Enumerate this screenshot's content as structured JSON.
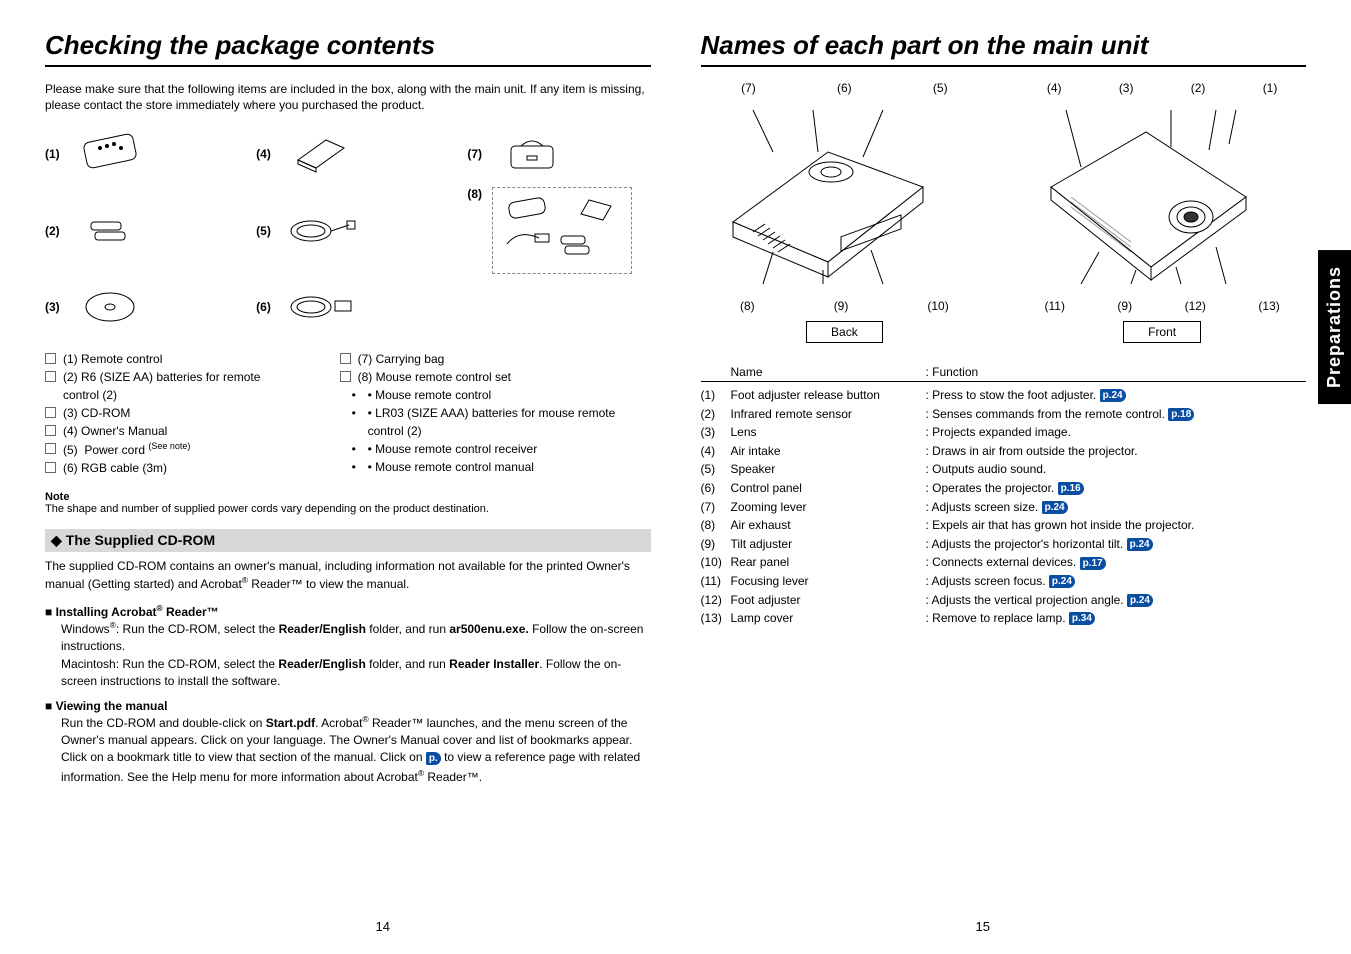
{
  "left": {
    "title": "Checking the package contents",
    "intro": "Please make sure that the following items are included in the box, along with the main unit. If any item is missing, please contact the store immediately where you purchased the product.",
    "item_labels": [
      "(1)",
      "(2)",
      "(3)",
      "(4)",
      "(5)",
      "(6)",
      "(7)",
      "(8)"
    ],
    "checklist_col1": [
      "(1)  Remote control",
      "(2)  R6 (SIZE AA) batteries for remote control (2)",
      "(3)  CD-ROM",
      "(4)  Owner's Manual",
      "(5)  Power cord (See note)",
      "(6)  RGB cable (3m)"
    ],
    "checklist_col2": [
      "(7)  Carrying bag",
      "(8)  Mouse remote control set"
    ],
    "checklist_col2_sub": [
      "• Mouse remote control",
      "• LR03 (SIZE AAA) batteries for mouse remote control (2)",
      "• Mouse remote control receiver",
      "• Mouse remote control manual"
    ],
    "note_head": "Note",
    "note_body": "The shape and number of supplied power cords vary depending on the product destination.",
    "cdrom_head": "The Supplied CD-ROM",
    "cdrom_text": "The supplied CD-ROM contains an owner's manual, including information not available for the printed Owner's manual (Getting started) and Acrobat® Reader™ to view the manual.",
    "install_head": "Installing Acrobat® Reader™",
    "install_win": "Windows®: Run the CD-ROM, select the Reader/English folder, and run ar500enu.exe. Follow the on-screen instructions.",
    "install_mac": "Macintosh: Run the CD-ROM, select the Reader/English folder, and run Reader Installer. Follow the on-screen instructions to install the software.",
    "view_head": "Viewing the manual",
    "view_text1": "Run the CD-ROM and double-click on Start.pdf. Acrobat® Reader™ launches, and the menu screen of the Owner's manual appears. Click on your language. The Owner's Manual cover and list of bookmarks appear. Click on a bookmark title to view that section of the manual. Click on ",
    "view_pref": "p.",
    "view_text2": " to view a reference page with related information. See the Help menu for more information about Acrobat® Reader™.",
    "page_num": "14"
  },
  "right": {
    "title": "Names of each part on the main unit",
    "back_top": [
      "(7)",
      "(6)",
      "(5)"
    ],
    "back_bottom": [
      "(8)",
      "(9)",
      "(10)"
    ],
    "front_top": [
      "(4)",
      "(3)",
      "(2)",
      "(1)"
    ],
    "front_bottom": [
      "(11)",
      "(9)",
      "(12)",
      "(13)"
    ],
    "back_label": "Back",
    "front_label": "Front",
    "side_tab": "Preparations",
    "table_head_name": "Name",
    "table_head_func": ": Function",
    "rows": [
      {
        "n": "(1)",
        "name": "Foot adjuster release button",
        "func": ": Press to stow the foot adjuster.",
        "p": "p.24"
      },
      {
        "n": "(2)",
        "name": "Infrared remote sensor",
        "func": ": Senses commands from the remote control.",
        "p": "p.18"
      },
      {
        "n": "(3)",
        "name": "Lens",
        "func": ": Projects expanded image.",
        "p": ""
      },
      {
        "n": "(4)",
        "name": "Air intake",
        "func": ": Draws in air from outside the projector.",
        "p": ""
      },
      {
        "n": "(5)",
        "name": "Speaker",
        "func": ": Outputs audio sound.",
        "p": ""
      },
      {
        "n": "(6)",
        "name": "Control panel",
        "func": ": Operates the projector.",
        "p": "p.16"
      },
      {
        "n": "(7)",
        "name": "Zooming lever",
        "func": ": Adjusts screen size.",
        "p": "p.24"
      },
      {
        "n": "(8)",
        "name": "Air exhaust",
        "func": ": Expels air that has grown hot inside the projector.",
        "p": ""
      },
      {
        "n": "(9)",
        "name": "Tilt adjuster",
        "func": ": Adjusts the projector's horizontal tilt.",
        "p": "p.24"
      },
      {
        "n": "(10)",
        "name": "Rear panel",
        "func": ": Connects external devices.",
        "p": "p.17"
      },
      {
        "n": "(11)",
        "name": "Focusing lever",
        "func": ": Adjusts screen focus.",
        "p": "p.24"
      },
      {
        "n": "(12)",
        "name": "Foot adjuster",
        "func": ": Adjusts the vertical projection angle.",
        "p": "p.24"
      },
      {
        "n": "(13)",
        "name": "Lamp cover",
        "func": ": Remove to replace lamp.",
        "p": "p.34"
      }
    ],
    "page_num": "15"
  }
}
